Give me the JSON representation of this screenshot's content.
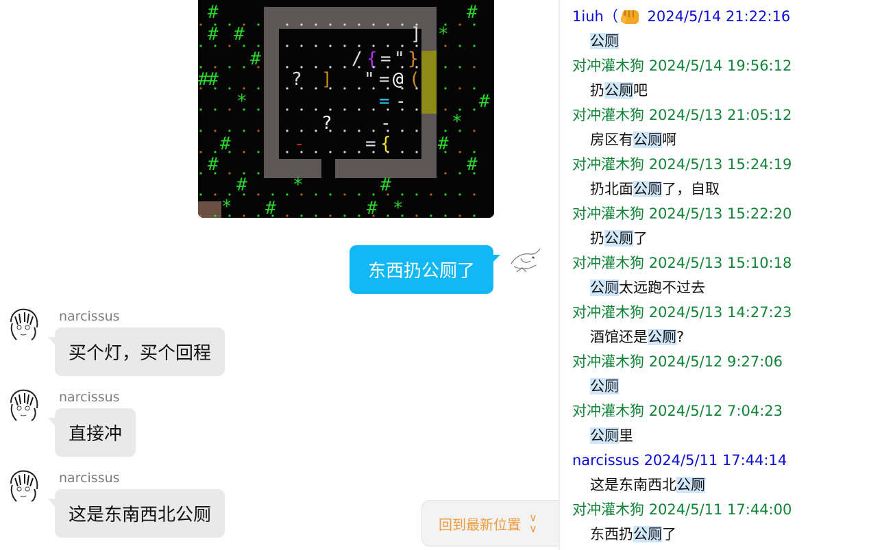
{
  "colors": {
    "my_bubble": "#12b7f5",
    "incoming_bubble": "#e9e9e9",
    "sender_green": "#128437",
    "sender_blue": "#0a0ad8",
    "highlight": "#cfe6fb",
    "jump_text": "#f19a3e"
  },
  "chat": {
    "image": {
      "icon": "roguelike-game-screenshot"
    },
    "outgoing": {
      "text": "东西扔公厕了",
      "avatar": "sketch-bird-avatar"
    },
    "incoming": [
      {
        "sender": "narcissus",
        "text": "买个灯，买个回程",
        "avatar": "sketch-girl-avatar"
      },
      {
        "sender": "narcissus",
        "text": "直接冲",
        "avatar": "sketch-girl-avatar"
      },
      {
        "sender": "narcissus",
        "text": "这是东南西北公厕",
        "avatar": "sketch-girl-avatar"
      }
    ],
    "jump_latest": {
      "label": "回到最新位置",
      "icon": "double-chevron-down-icon"
    }
  },
  "history": [
    {
      "sender": "1iuh（",
      "emoji": "fist-emoji",
      "time": "2024/5/14 21:22:16",
      "color": "blue",
      "parts": [
        {
          "t": "公厕",
          "hl": true
        }
      ]
    },
    {
      "sender": "对冲灌木狗",
      "time": "2024/5/14 19:56:12",
      "color": "green",
      "parts": [
        {
          "t": "扔",
          "hl": false
        },
        {
          "t": "公厕",
          "hl": true
        },
        {
          "t": "吧",
          "hl": false
        }
      ]
    },
    {
      "sender": "对冲灌木狗",
      "time": "2024/5/13 21:05:12",
      "color": "green",
      "parts": [
        {
          "t": "房区有",
          "hl": false
        },
        {
          "t": "公厕",
          "hl": true
        },
        {
          "t": "啊",
          "hl": false
        }
      ]
    },
    {
      "sender": "对冲灌木狗",
      "time": "2024/5/13 15:24:19",
      "color": "green",
      "parts": [
        {
          "t": "扔北面",
          "hl": false
        },
        {
          "t": "公厕",
          "hl": true
        },
        {
          "t": "了，自取",
          "hl": false
        }
      ]
    },
    {
      "sender": "对冲灌木狗",
      "time": "2024/5/13 15:22:20",
      "color": "green",
      "parts": [
        {
          "t": "扔",
          "hl": false
        },
        {
          "t": "公厕",
          "hl": true
        },
        {
          "t": "了",
          "hl": false
        }
      ]
    },
    {
      "sender": "对冲灌木狗",
      "time": "2024/5/13 15:10:18",
      "color": "green",
      "parts": [
        {
          "t": "公厕",
          "hl": true
        },
        {
          "t": "太远跑不过去",
          "hl": false
        }
      ]
    },
    {
      "sender": "对冲灌木狗",
      "time": "2024/5/13 14:27:23",
      "color": "green",
      "parts": [
        {
          "t": "酒馆还是",
          "hl": false
        },
        {
          "t": "公厕",
          "hl": true
        },
        {
          "t": "?",
          "hl": false
        }
      ]
    },
    {
      "sender": "对冲灌木狗",
      "time": "2024/5/12 9:27:06",
      "color": "green",
      "parts": [
        {
          "t": "公厕",
          "hl": true
        }
      ]
    },
    {
      "sender": "对冲灌木狗",
      "time": "2024/5/12 7:04:23",
      "color": "green",
      "parts": [
        {
          "t": "公厕",
          "hl": true
        },
        {
          "t": "里",
          "hl": false
        }
      ]
    },
    {
      "sender": "narcissus",
      "time": "2024/5/11 17:44:14",
      "color": "blue",
      "parts": [
        {
          "t": "这是东南西北",
          "hl": false
        },
        {
          "t": "公厕",
          "hl": true
        }
      ]
    },
    {
      "sender": "对冲灌木狗",
      "time": "2024/5/11 17:44:00",
      "color": "green",
      "parts": [
        {
          "t": "东西扔",
          "hl": false
        },
        {
          "t": "公厕",
          "hl": true
        },
        {
          "t": "了",
          "hl": false
        }
      ]
    }
  ]
}
